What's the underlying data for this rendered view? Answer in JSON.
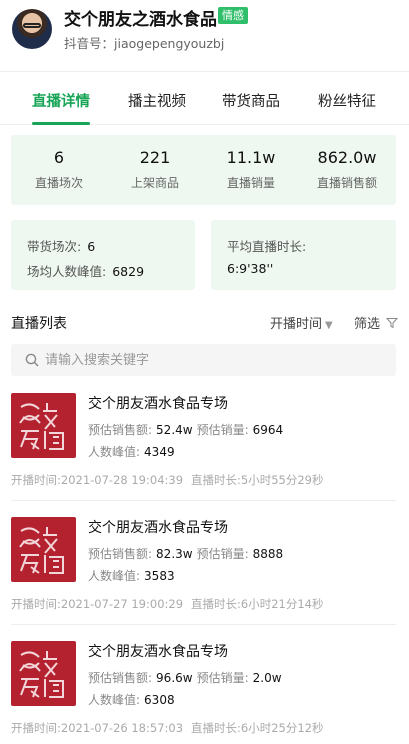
{
  "header": {
    "shop_name": "交个朋友之酒水食品",
    "badge": "情感",
    "account_label": "抖音号：",
    "account_id": "jiaogepengyouzbj"
  },
  "tabs": [
    {
      "label": "直播详情",
      "active": true
    },
    {
      "label": "播主视频",
      "active": false
    },
    {
      "label": "带货商品",
      "active": false
    },
    {
      "label": "粉丝特征",
      "active": false
    }
  ],
  "stats": [
    {
      "value": "6",
      "label": "直播场次"
    },
    {
      "value": "221",
      "label": "上架商品"
    },
    {
      "value": "11.1w",
      "label": "直播销量"
    },
    {
      "value": "862.0w",
      "label": "直播销售额"
    }
  ],
  "info_left": {
    "sessions_label": "带货场次:",
    "sessions_value": "6",
    "peak_label": "场均人数峰值:",
    "peak_value": "6829"
  },
  "info_right": {
    "avg_duration_label": "平均直播时长:",
    "avg_duration_value": "6:9'38''"
  },
  "list": {
    "title": "直播列表",
    "sort_label": "开播时间",
    "filter_label": "筛选",
    "search_placeholder": "请输入搜索关键字",
    "items": [
      {
        "title": "交个朋友酒水食品专场",
        "sales_amount_label": "预估销售额:",
        "sales_amount": "52.4w",
        "sales_volume_label": "预估销量:",
        "sales_volume": "6964",
        "peak_label": "人数峰值:",
        "peak": "4349",
        "start_label": "开播时间:",
        "start_time": "2021-07-28 19:04:39",
        "duration_label": "直播时长:",
        "duration": "5小时55分29秒"
      },
      {
        "title": "交个朋友酒水食品专场",
        "sales_amount_label": "预估销售额:",
        "sales_amount": "82.3w",
        "sales_volume_label": "预估销量:",
        "sales_volume": "8888",
        "peak_label": "人数峰值:",
        "peak": "3583",
        "start_label": "开播时间:",
        "start_time": "2021-07-27 19:00:29",
        "duration_label": "直播时长:",
        "duration": "6小时21分14秒"
      },
      {
        "title": "交个朋友酒水食品专场",
        "sales_amount_label": "预估销售额:",
        "sales_amount": "96.6w",
        "sales_volume_label": "预估销量:",
        "sales_volume": "2.0w",
        "peak_label": "人数峰值:",
        "peak": "6308",
        "start_label": "开播时间:",
        "start_time": "2021-07-26 18:57:03",
        "duration_label": "直播时长:",
        "duration": "6小时25分12秒"
      }
    ]
  },
  "colors": {
    "accent": "#18a456",
    "badge": "#2fbf6a",
    "stat_bg": "#eef8f0",
    "thumb_red": "#b5222f"
  },
  "icons": {
    "sort": "triangle-down-icon",
    "filter": "funnel-icon",
    "search": "search-icon",
    "thumb": "jiaogepengyou-logo-icon"
  }
}
